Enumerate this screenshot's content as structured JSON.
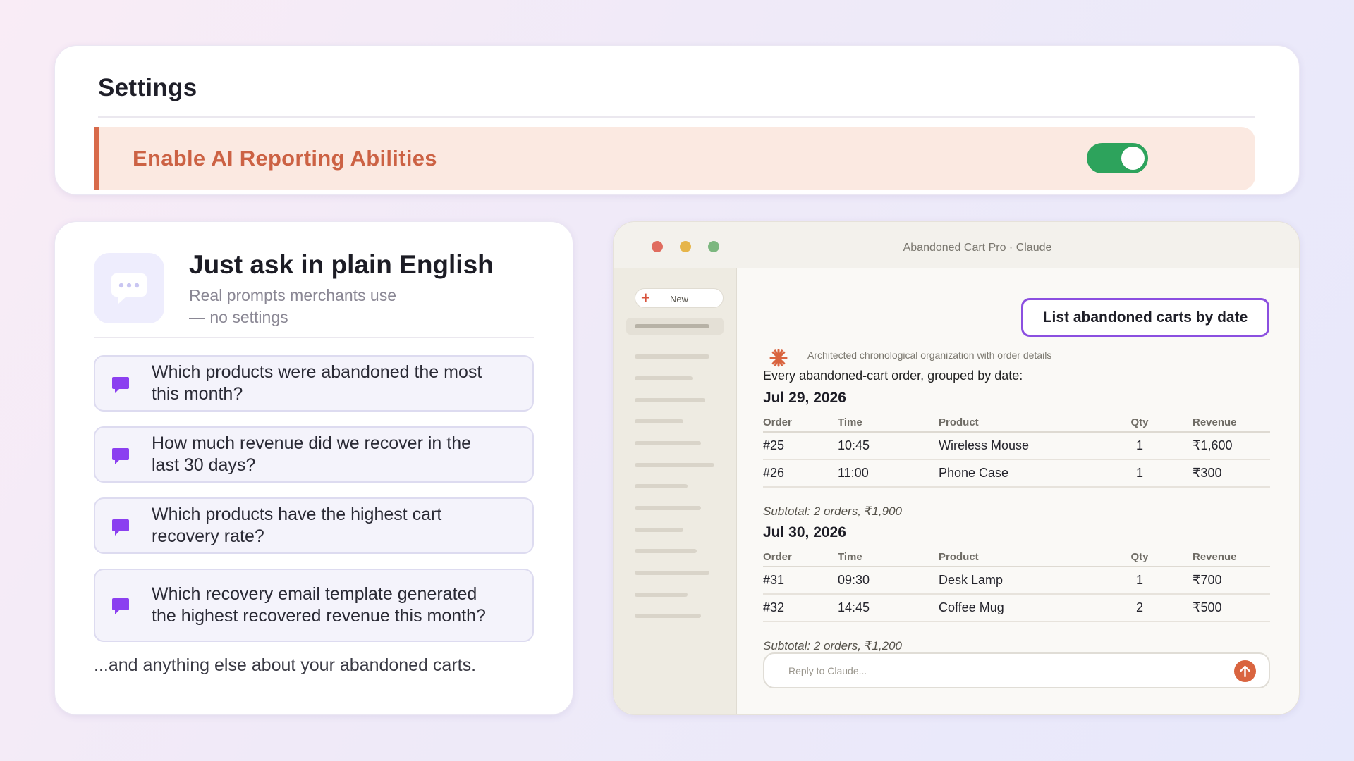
{
  "settings": {
    "title": "Settings",
    "ai_reporting_label": "Enable AI Reporting Abilities",
    "ai_reporting_enabled": true
  },
  "prompts": {
    "title": "Just ask in plain English",
    "subtitle_line1": "Real prompts merchants use",
    "subtitle_line2": "— no settings",
    "items": [
      {
        "line1": "Which products were abandoned the most",
        "line2": "this month?"
      },
      {
        "line1": "How much revenue did we recover in the",
        "line2": "last 30 days?"
      },
      {
        "line1": "Which products have the highest cart",
        "line2": "recovery rate?"
      },
      {
        "line1": "Which recovery email template generated",
        "line2": "the highest recovered revenue this month?"
      }
    ],
    "footer": "...and anything else about your abandoned carts."
  },
  "window": {
    "title": "Abandoned Cart Pro · Claude",
    "sidebar": {
      "new_label": "New"
    },
    "user_message": "List abandoned carts by date",
    "thinking_note": "Architected chronological organization with order details",
    "intro": "Every abandoned-cart order, grouped by date:",
    "columns": {
      "order": "Order",
      "time": "Time",
      "product": "Product",
      "qty": "Qty",
      "revenue": "Revenue"
    },
    "groups": [
      {
        "date": "Jul 29, 2026",
        "rows": [
          {
            "order": "#25",
            "time": "10:45",
            "product": "Wireless Mouse",
            "qty": "1",
            "revenue": "₹1,600"
          },
          {
            "order": "#26",
            "time": "11:00",
            "product": "Phone Case",
            "qty": "1",
            "revenue": "₹300"
          }
        ],
        "subtotal": "Subtotal: 2 orders, ₹1,900"
      },
      {
        "date": "Jul 30, 2026",
        "rows": [
          {
            "order": "#31",
            "time": "09:30",
            "product": "Desk Lamp",
            "qty": "1",
            "revenue": "₹700"
          },
          {
            "order": "#32",
            "time": "14:45",
            "product": "Coffee Mug",
            "qty": "2",
            "revenue": "₹500"
          }
        ],
        "subtotal": "Subtotal: 2 orders, ₹1,200"
      }
    ],
    "reply_placeholder": "Reply to Claude..."
  },
  "colors": {
    "accent_orange": "#d86a4a",
    "toggle_green": "#2da35c",
    "prompt_purple": "#8b3ff0",
    "bubble_border": "#8b4fe0"
  },
  "icons": {
    "badge": "speech-bubble-icon",
    "prompt": "chat-bubble-icon",
    "assistant": "claude-spark-icon",
    "send": "arrow-up-icon",
    "new": "plus-icon"
  }
}
